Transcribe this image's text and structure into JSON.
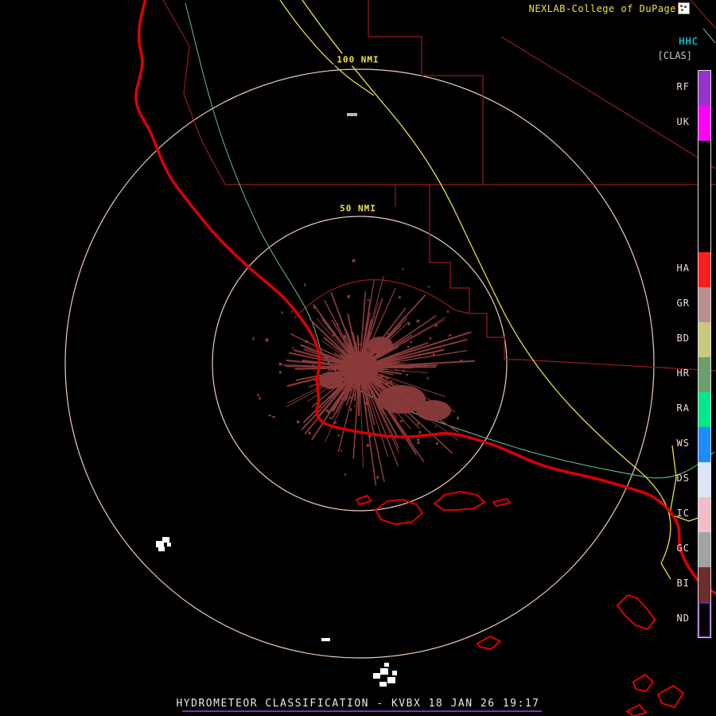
{
  "header": {
    "brand": "NEXLAB-College of DuPage"
  },
  "legend": {
    "product_code": "HHC",
    "product_mode": "[CLAS]",
    "items": [
      {
        "code": "RF",
        "color": "#9932CC"
      },
      {
        "code": "UK",
        "color": "#FF00FF"
      },
      {
        "code": "HA",
        "color": "#FF1E1E"
      },
      {
        "code": "GR",
        "color": "#BC8F8F"
      },
      {
        "code": "BD",
        "color": "#C9C97E"
      },
      {
        "code": "HR",
        "color": "#6E9E6E"
      },
      {
        "code": "RA",
        "color": "#00E88C"
      },
      {
        "code": "WS",
        "color": "#1E8CFF"
      },
      {
        "code": "DS",
        "color": "#DCE6F5"
      },
      {
        "code": "IC",
        "color": "#F2BCC9"
      },
      {
        "code": "GC",
        "color": "#A2A2A2"
      },
      {
        "code": "BI",
        "color": "#6E2E2E"
      },
      {
        "code": "ND",
        "color": "#000000",
        "border": "#7B2FBE"
      }
    ]
  },
  "map": {
    "outer_ring_label": "100 NMI",
    "inner_ring_label": "50 NMI"
  },
  "footer": {
    "caption": "HYDROMETEOR CLASSIFICATION - KVBX 18 JAN 26 19:17"
  },
  "colors": {
    "coastline": "#DD0000",
    "county": "#9B1B1B",
    "highway": "#E8E040",
    "river": "#66C28F",
    "ring": "#EDCDB8",
    "clutter": "#8B3A3A",
    "underline": "#7B2FBE",
    "brand_text": "#F2E23C",
    "legend_label": "#F2DCD2",
    "ring_label": "#F2E23C",
    "hhc_text": "#00FFFF",
    "clas_text": "#C8C8C8"
  }
}
